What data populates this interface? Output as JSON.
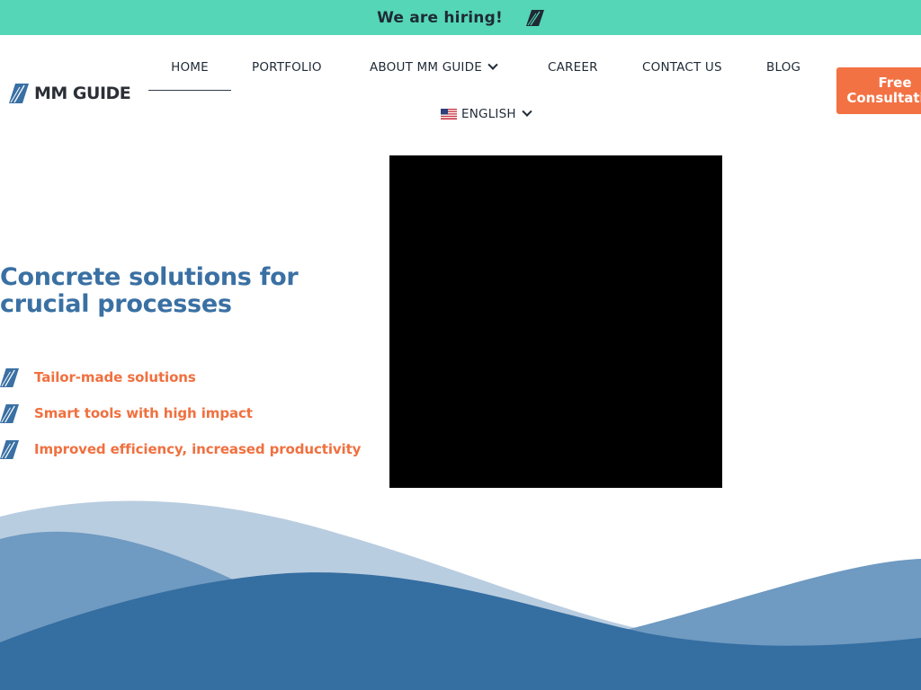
{
  "banner": {
    "text": "We are hiring!",
    "icon": "mm-guide-mark-icon",
    "color": "#55d6b6"
  },
  "logo": {
    "text": "MM GUIDE",
    "icon": "mm-guide-mark-icon"
  },
  "nav": {
    "home": "HOME",
    "portfolio": "PORTFOLIO",
    "about": "ABOUT MM GUIDE",
    "career": "CAREER",
    "contact": "CONTACT US",
    "blog": "BLOG",
    "language": "ENGLISH",
    "language_icon": "us-flag-icon",
    "active": "HOME"
  },
  "cta": {
    "line1": "Free",
    "line2": "Consultation",
    "color": "#f37243"
  },
  "hero": {
    "title": "Concrete solutions for crucial processes",
    "features": [
      {
        "text": "Tailor-made solutions",
        "icon": "mm-guide-mark-icon"
      },
      {
        "text": "Smart tools with high impact",
        "icon": "mm-guide-mark-icon"
      },
      {
        "text": "Improved efficiency, increased productivity",
        "icon": "mm-guide-mark-icon"
      }
    ],
    "title_color": "#3a70a3",
    "feature_color": "#f0703f"
  },
  "waves": {
    "colors": [
      "#b9cde0",
      "#6f9ac1",
      "#356ea1"
    ]
  }
}
